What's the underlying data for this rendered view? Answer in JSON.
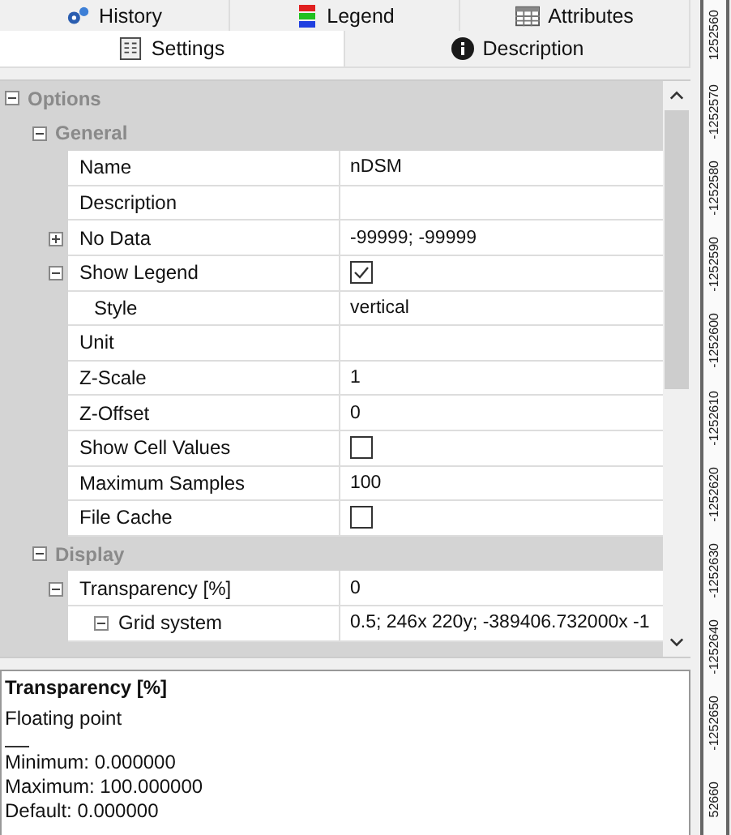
{
  "tabs_top": [
    {
      "label": "History",
      "kind": "history",
      "selected": false
    },
    {
      "label": "Legend",
      "kind": "legend",
      "selected": false
    },
    {
      "label": "Attributes",
      "kind": "table",
      "selected": false
    }
  ],
  "tabs_bottom": [
    {
      "label": "Settings",
      "kind": "settings",
      "selected": true
    },
    {
      "label": "Description",
      "kind": "info",
      "selected": false
    }
  ],
  "grid": {
    "items": [
      {
        "kind": "category",
        "label": "Options",
        "expanded": true,
        "children": [
          {
            "kind": "category",
            "label": "General",
            "expanded": true,
            "children": [
              {
                "kind": "text",
                "label": "Name",
                "value": "nDSM"
              },
              {
                "kind": "text",
                "label": "Description"
              },
              {
                "kind": "text",
                "label": "No Data",
                "value": "-99999; -99999",
                "expanded": false
              },
              {
                "kind": "checkbox",
                "label": "Show Legend",
                "checked": true,
                "expanded": true,
                "children": [
                  {
                    "kind": "text",
                    "label": "Style",
                    "value": "vertical"
                  }
                ]
              },
              {
                "kind": "text",
                "label": "Unit"
              },
              {
                "kind": "text",
                "label": "Z-Scale",
                "value": "1"
              },
              {
                "kind": "text",
                "label": "Z-Offset",
                "value": "0"
              },
              {
                "kind": "checkbox",
                "label": "Show Cell Values",
                "checked": false
              },
              {
                "kind": "text",
                "label": "Maximum Samples",
                "value": "100"
              },
              {
                "kind": "checkbox",
                "label": "File Cache",
                "checked": false
              }
            ]
          },
          {
            "kind": "category",
            "label": "Display",
            "expanded": true,
            "children": [
              {
                "kind": "text",
                "label": "Transparency [%]",
                "value": "0",
                "expanded": true,
                "children": [
                  {
                    "kind": "text",
                    "label": "Grid system",
                    "value": "0.5; 246x 220y; -389406.732000x -1",
                    "expanded": true
                  }
                ]
              }
            ]
          }
        ]
      }
    ]
  },
  "description": {
    "title": "Transparency [%]",
    "type": "Floating point",
    "lines": [
      "Minimum: 0.000000",
      "Maximum: 100.000000",
      "Default: 0.000000"
    ]
  },
  "ruler": {
    "labels": [
      "1252560",
      "-1252570",
      "-1252580",
      "-1252590",
      "-1252600",
      "-1252610",
      "-1252620",
      "-1252630",
      "-1252640",
      "-1252650",
      "52660"
    ]
  }
}
